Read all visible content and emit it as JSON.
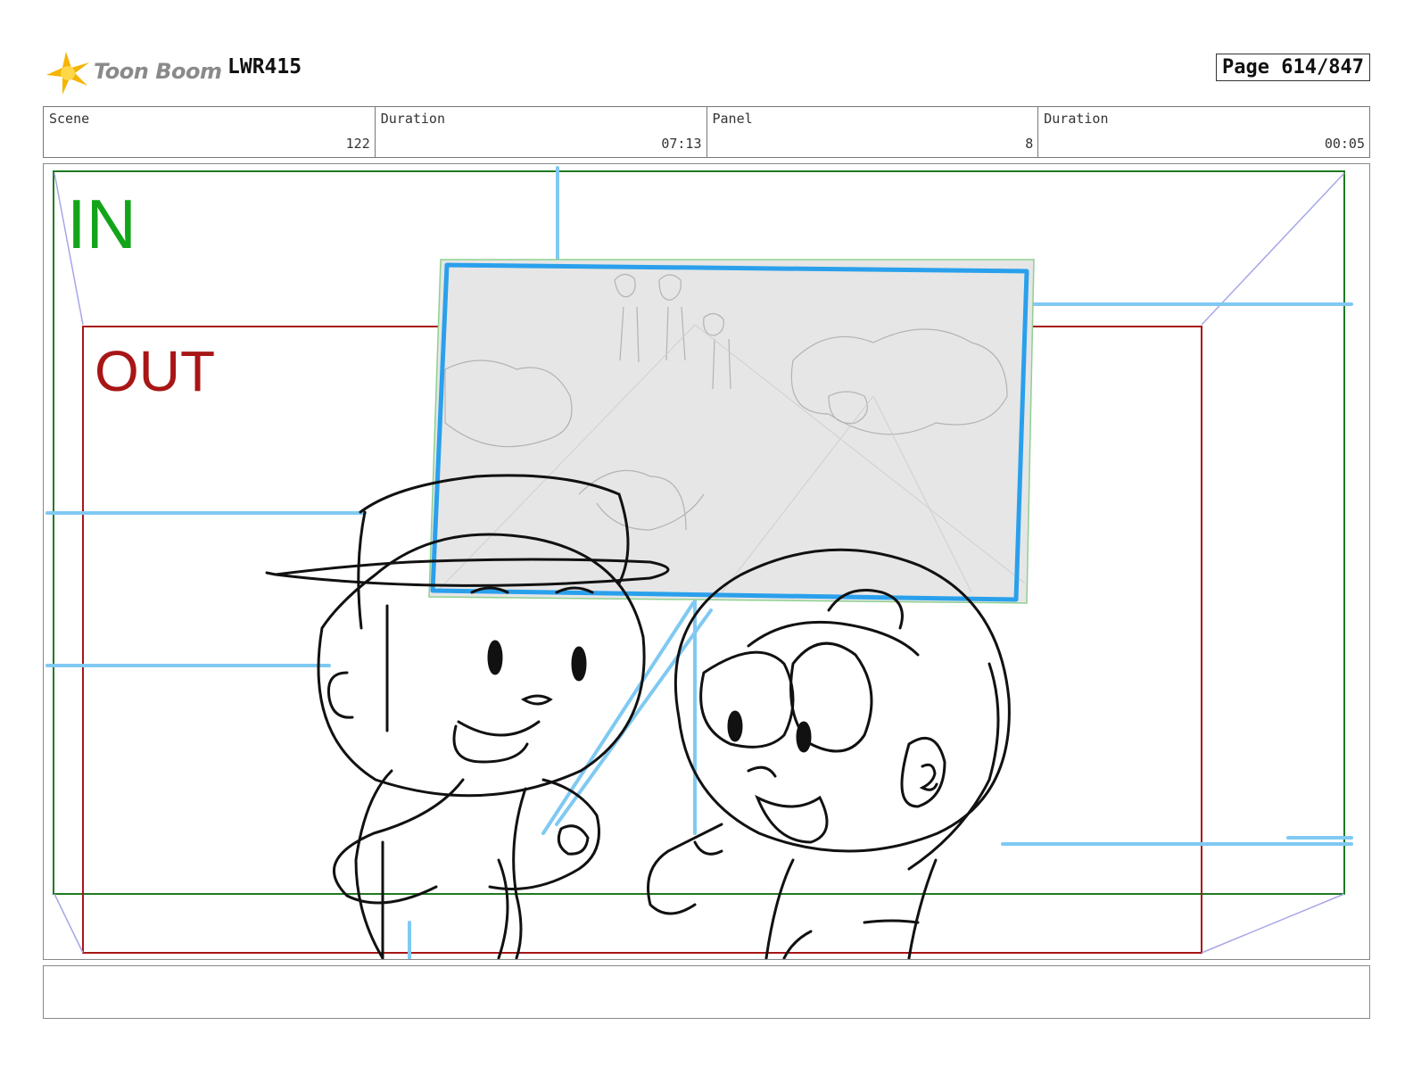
{
  "header": {
    "logo_text": "Toon Boom",
    "project": "LWR415",
    "page": "Page 614/847"
  },
  "info": {
    "scene_label": "Scene",
    "scene_value": "122",
    "duration_label": "Duration",
    "duration_value": "07:13",
    "panel_label": "Panel",
    "panel_value": "8",
    "panel_duration_label": "Duration",
    "panel_duration_value": "00:05"
  },
  "frame": {
    "in_label": "IN",
    "out_label": "OUT",
    "in_color": "#13a41a",
    "out_color": "#a81616",
    "guide_color": "#7fc9f2"
  },
  "notes": {
    "text": ""
  }
}
